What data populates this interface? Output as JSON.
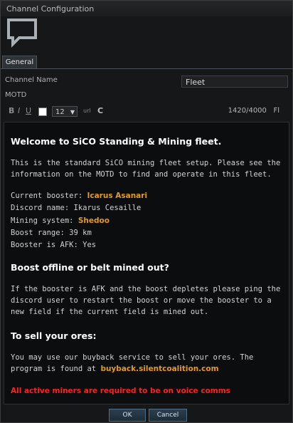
{
  "window": {
    "title": "Channel Configuration"
  },
  "tabs": [
    {
      "label": "General"
    }
  ],
  "form": {
    "channel_name_label": "Channel Name",
    "channel_name_value": "Fleet",
    "motd_label": "MOTD"
  },
  "toolbar": {
    "bold": "B",
    "italic": "I",
    "underline": "U",
    "font_size": "12",
    "link": "url",
    "clear": "C",
    "char_count": "1420/4000",
    "char_count_suffix": "Fl"
  },
  "motd": {
    "heading1": "Welcome to SiCO Standing & Mining fleet.",
    "intro": "This is the standard SiCO mining fleet setup. Please see the information on the MOTD to find and operate in this fleet.",
    "booster_label": "Current booster: ",
    "booster_value": "Icarus Asanari",
    "discord": "Discord name: Ikarus Cesaille",
    "system_label": "Mining system: ",
    "system_value": "Shedoo",
    "boost_range": "Boost range: 39 km",
    "afk": "Booster is AFK: Yes",
    "heading2": "Boost offline or belt mined out?",
    "boost_text": "If the booster is AFK and the boost depletes please ping the discord user to restart the boost or move the booster to a new field if the current field is mined out.",
    "heading3": "To sell your ores:",
    "sell_text": "You may use our buyback service to sell your ores. The program is found at ",
    "sell_link": "buyback.silentcoalition.com",
    "warning": "All active miners are required to be on voice comms"
  },
  "buttons": {
    "ok": "OK",
    "cancel": "Cancel"
  },
  "colors": {
    "accent_orange": "#e59926",
    "warning_red": "#ff2020",
    "button_blue": "#2c3f4e"
  },
  "icons": {
    "header": "chat-bubble-icon",
    "size_dropdown": "chevron-down-icon"
  }
}
